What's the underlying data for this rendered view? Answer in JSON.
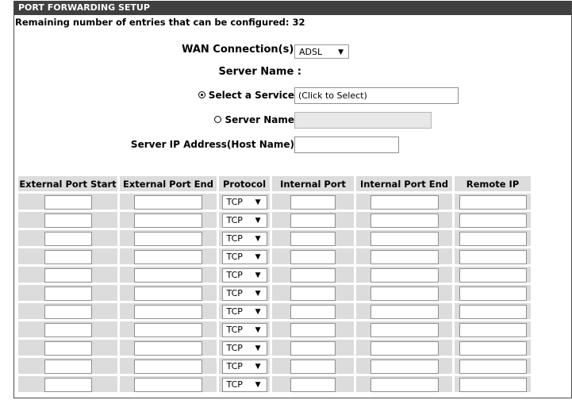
{
  "header": {
    "title": "PORT FORWARDING SETUP"
  },
  "remaining_text": "Remaining number of entries that can be configured: 32",
  "form": {
    "wan_label": "WAN Connection(s) :",
    "wan_value": "ADSL",
    "server_name_heading": "Server Name :",
    "select_service_label": "Select a Service :",
    "select_service_value": "(Click to Select)",
    "server_name_label": "Server Name :",
    "server_name_value": "",
    "server_ip_label": "Server IP Address(Host Name) :",
    "server_ip_value": ""
  },
  "icons": {
    "dropdown_arrow": "▼"
  },
  "table": {
    "headers": [
      "External Port Start",
      "External Port End",
      "Protocol",
      "Internal Port",
      "Internal Port End",
      "Remote IP"
    ],
    "rows": [
      {
        "protocol": "TCP"
      },
      {
        "protocol": "TCP"
      },
      {
        "protocol": "TCP"
      },
      {
        "protocol": "TCP"
      },
      {
        "protocol": "TCP"
      },
      {
        "protocol": "TCP"
      },
      {
        "protocol": "TCP"
      },
      {
        "protocol": "TCP"
      },
      {
        "protocol": "TCP"
      },
      {
        "protocol": "TCP"
      },
      {
        "protocol": "TCP"
      }
    ]
  }
}
